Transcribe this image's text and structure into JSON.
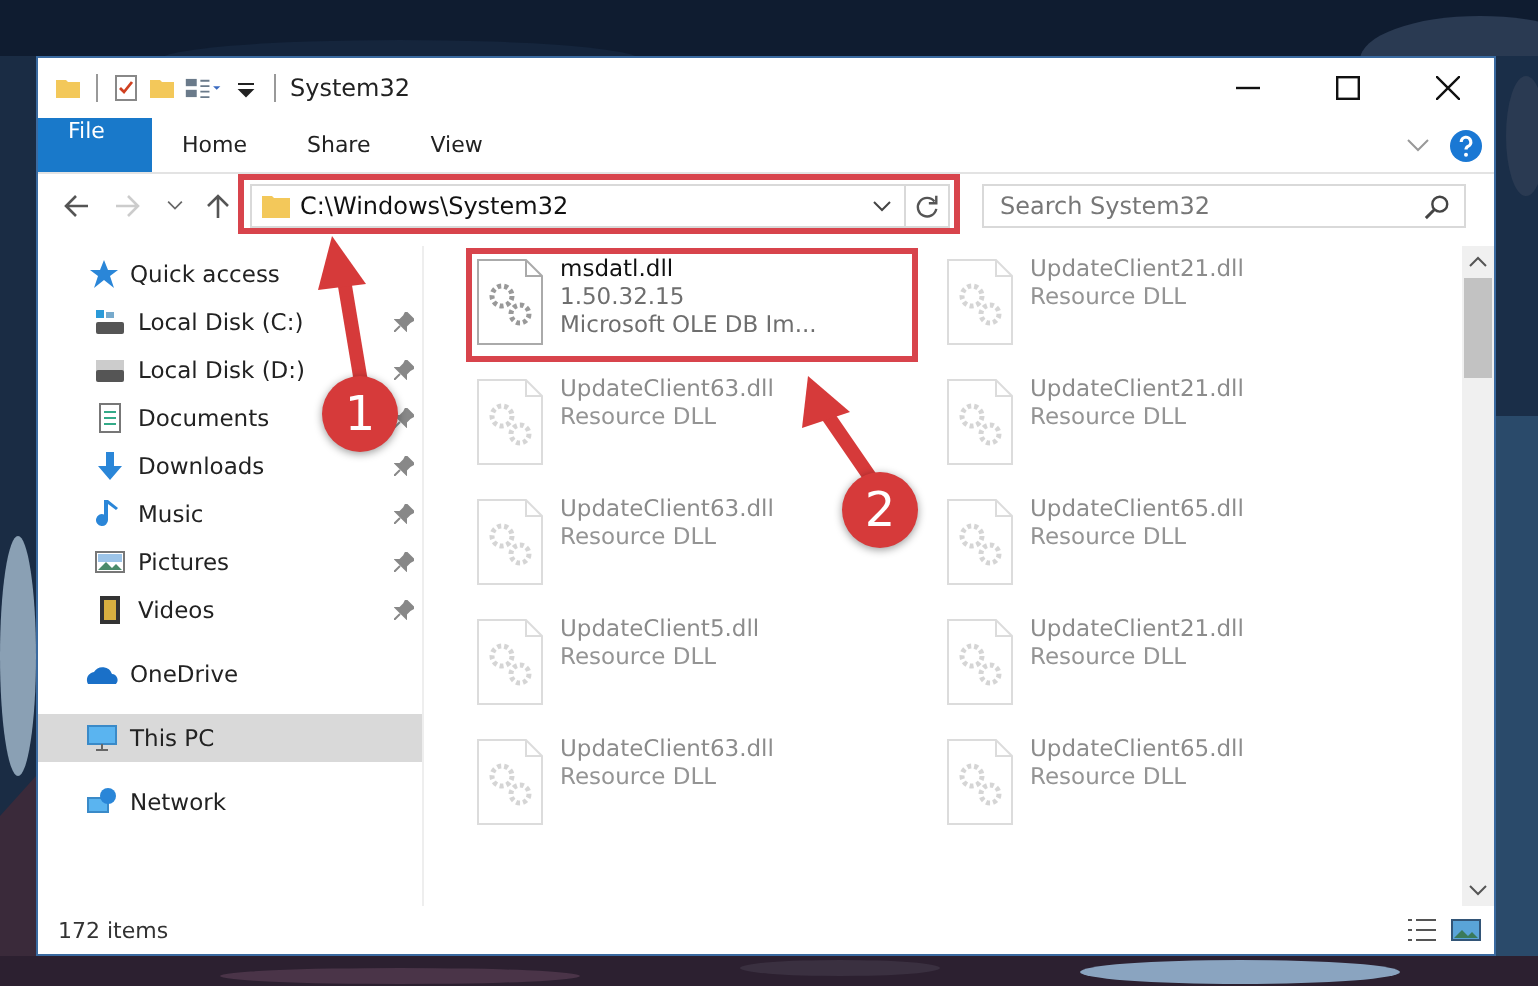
{
  "window": {
    "title": "System32"
  },
  "ribbon_tabs": [
    {
      "label": "File",
      "kind": "file",
      "selected": false
    },
    {
      "label": "Home",
      "kind": "tab",
      "selected": false
    },
    {
      "label": "Share",
      "kind": "tab",
      "selected": false
    },
    {
      "label": "View",
      "kind": "tab",
      "selected": false
    }
  ],
  "address": {
    "value": "C:\\Windows\\System32"
  },
  "search": {
    "placeholder": "Search System32"
  },
  "sidebar": {
    "items": [
      {
        "label": "Quick access",
        "kind": "quick",
        "selected": false,
        "children": [
          {
            "label": "Local Disk (C:)",
            "kind": "drive-c",
            "pinned": true,
            "selected": false
          },
          {
            "label": "Local Disk (D:)",
            "kind": "drive",
            "pinned": true,
            "selected": false
          },
          {
            "label": "Documents",
            "kind": "documents",
            "pinned": true,
            "selected": false
          },
          {
            "label": "Downloads",
            "kind": "downloads",
            "pinned": true,
            "selected": false
          },
          {
            "label": "Music",
            "kind": "music",
            "pinned": true,
            "selected": false
          },
          {
            "label": "Pictures",
            "kind": "pictures",
            "pinned": true,
            "selected": false
          },
          {
            "label": "Videos",
            "kind": "videos",
            "pinned": true,
            "selected": false
          }
        ]
      },
      {
        "label": "OneDrive",
        "kind": "onedrive",
        "selected": false
      },
      {
        "label": "This PC",
        "kind": "pc",
        "selected": true
      },
      {
        "label": "Network",
        "kind": "network",
        "selected": false
      }
    ]
  },
  "files": [
    {
      "name": "msdatl.dll",
      "version": "1.50.32.15",
      "description": "Microsoft OLE DB Im...",
      "faded": false,
      "highlighted": true
    },
    {
      "name": "UpdateClient21.dll",
      "description": "Resource DLL",
      "faded": true
    },
    {
      "name": "UpdateClient63.dll",
      "description": "Resource DLL",
      "faded": true
    },
    {
      "name": "UpdateClient21.dll",
      "description": "Resource DLL",
      "faded": true
    },
    {
      "name": "UpdateClient63.dll",
      "description": "Resource DLL",
      "faded": true
    },
    {
      "name": "UpdateClient65.dll",
      "description": "Resource DLL",
      "faded": true
    },
    {
      "name": "UpdateClient5.dll",
      "description": "Resource DLL",
      "faded": true
    },
    {
      "name": "UpdateClient21.dll",
      "description": "Resource DLL",
      "faded": true
    },
    {
      "name": "UpdateClient63.dll",
      "description": "Resource DLL",
      "faded": true
    },
    {
      "name": "UpdateClient65.dll",
      "description": "Resource DLL",
      "faded": true
    }
  ],
  "status_bar": {
    "item_count": "172 items"
  },
  "annotations": [
    {
      "label": "1"
    },
    {
      "label": "2"
    }
  ]
}
